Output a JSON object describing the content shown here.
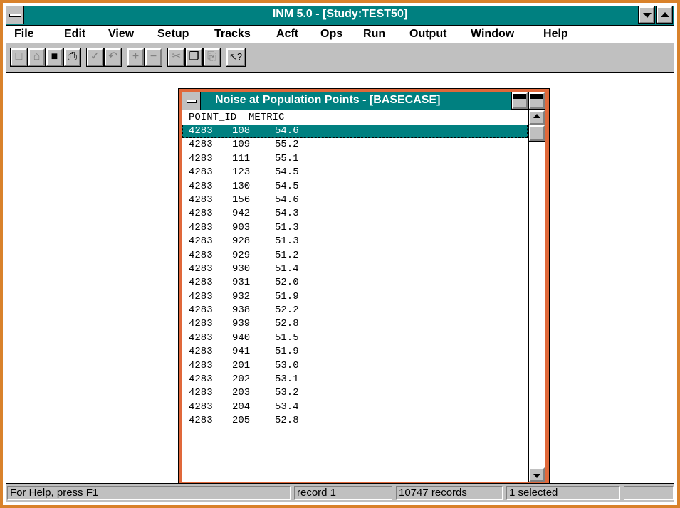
{
  "app": {
    "title": "INM 5.0 - [Study:TEST50]"
  },
  "menu": [
    "File",
    "Edit",
    "View",
    "Setup",
    "Tracks",
    "Acft",
    "Ops",
    "Run",
    "Output",
    "Window",
    "Help"
  ],
  "toolbar": {
    "buttons": [
      {
        "icon": "new-file-icon",
        "glyph": "□",
        "enabled": false
      },
      {
        "icon": "open-folder-icon",
        "glyph": "⌂",
        "enabled": false
      },
      {
        "icon": "save-disk-icon",
        "glyph": "■",
        "enabled": true
      },
      {
        "icon": "print-icon",
        "glyph": "⎙",
        "enabled": true
      },
      {
        "icon": "check-icon",
        "glyph": "✓",
        "enabled": false
      },
      {
        "icon": "undo-icon",
        "glyph": "↶",
        "enabled": false
      },
      {
        "icon": "plus-icon",
        "glyph": "+",
        "enabled": false
      },
      {
        "icon": "minus-icon",
        "glyph": "−",
        "enabled": false
      },
      {
        "icon": "cut-icon",
        "glyph": "✂",
        "enabled": false
      },
      {
        "icon": "copy-icon",
        "glyph": "❐",
        "enabled": true
      },
      {
        "icon": "paste-icon",
        "glyph": "⎘",
        "enabled": false
      },
      {
        "icon": "context-help-icon",
        "glyph": "↖?",
        "enabled": true
      }
    ]
  },
  "child_window": {
    "title": "Noise at Population Points - [BASECASE]",
    "header": "POINT_ID  METRIC",
    "rows": [
      [
        "4283",
        "108",
        "54.6"
      ],
      [
        "4283",
        "109",
        "55.2"
      ],
      [
        "4283",
        "111",
        "55.1"
      ],
      [
        "4283",
        "123",
        "54.5"
      ],
      [
        "4283",
        "130",
        "54.5"
      ],
      [
        "4283",
        "156",
        "54.6"
      ],
      [
        "4283",
        "942",
        "54.3"
      ],
      [
        "4283",
        "903",
        "51.3"
      ],
      [
        "4283",
        "928",
        "51.3"
      ],
      [
        "4283",
        "929",
        "51.2"
      ],
      [
        "4283",
        "930",
        "51.4"
      ],
      [
        "4283",
        "931",
        "52.0"
      ],
      [
        "4283",
        "932",
        "51.9"
      ],
      [
        "4283",
        "938",
        "52.2"
      ],
      [
        "4283",
        "939",
        "52.8"
      ],
      [
        "4283",
        "940",
        "51.5"
      ],
      [
        "4283",
        "941",
        "51.9"
      ],
      [
        "4283",
        "201",
        "53.0"
      ],
      [
        "4283",
        "202",
        "53.1"
      ],
      [
        "4283",
        "203",
        "53.2"
      ],
      [
        "4283",
        "204",
        "53.4"
      ],
      [
        "4283",
        "205",
        "52.8"
      ]
    ],
    "selected_index": 0
  },
  "status": {
    "help": "For Help, press F1",
    "record": "record 1",
    "count": "10747 records",
    "selected": "1 selected"
  },
  "colors": {
    "titlebar": "#008080",
    "frame": "#d9822b",
    "child_frame": "#e0683a",
    "face": "#c0c0c0"
  }
}
